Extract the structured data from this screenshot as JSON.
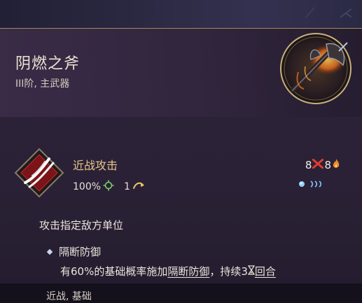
{
  "item": {
    "name": "阴燃之斧",
    "subtitle": "III阶, 主武器",
    "weapon_icon": "smoldering-axe-icon"
  },
  "skill": {
    "icon": "slash-claw-icon",
    "name": "近战攻击",
    "accuracy": "100%",
    "accuracy_icon": "accuracy-crosshair-icon",
    "range": "1",
    "range_icon": "range-arrow-icon",
    "cost_a": "8",
    "cost_a_icon": "red-damage-icon",
    "cost_b": "8",
    "cost_b_icon": "fire-icon",
    "pips": [
      "action-point-icon",
      "movement-chevrons-icon"
    ]
  },
  "description": "攻击指定敌方单位",
  "effect": {
    "title": "隔断防御",
    "text_prefix": "有60%的基础概率施加",
    "link_1": "隔断防御",
    "text_mid": "，持续3",
    "duration_icon": "hourglass-icon",
    "link_2": "回合"
  },
  "tags": "近战, 基础",
  "colors": {
    "title": "#ece3d2",
    "skill_name": "#e8c48a",
    "border_gold": "#a08a5a",
    "panel": "#2a2035"
  }
}
